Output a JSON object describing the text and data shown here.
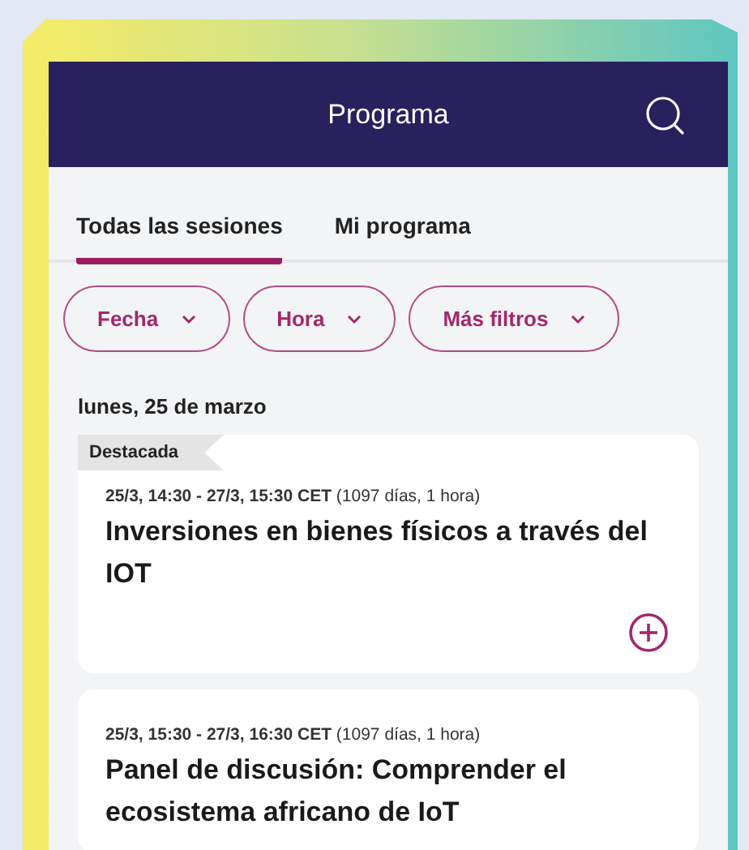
{
  "header": {
    "title": "Programa"
  },
  "tabs": [
    {
      "label": "Todas las sesiones",
      "selected": true
    },
    {
      "label": "Mi programa",
      "selected": false
    }
  ],
  "filters": [
    "Fecha",
    "Hora",
    "Más filtros"
  ],
  "date_heading": "lunes, 25 de marzo",
  "sessions": [
    {
      "badge": "Destacada",
      "time": "**25/3, 14:30 - 27/3, 15:30 CET** (1097 días, 1 hora)",
      "title": "Inversiones en bienes físicos a través del IOT",
      "add_button": true
    },
    {
      "time": "**25/3, 15:30 - 27/3, 16:30 CET** (1097 días, 1 hora)",
      "title": "Panel de discusión: Comprender el ecosistema africano de IoT"
    }
  ]
}
